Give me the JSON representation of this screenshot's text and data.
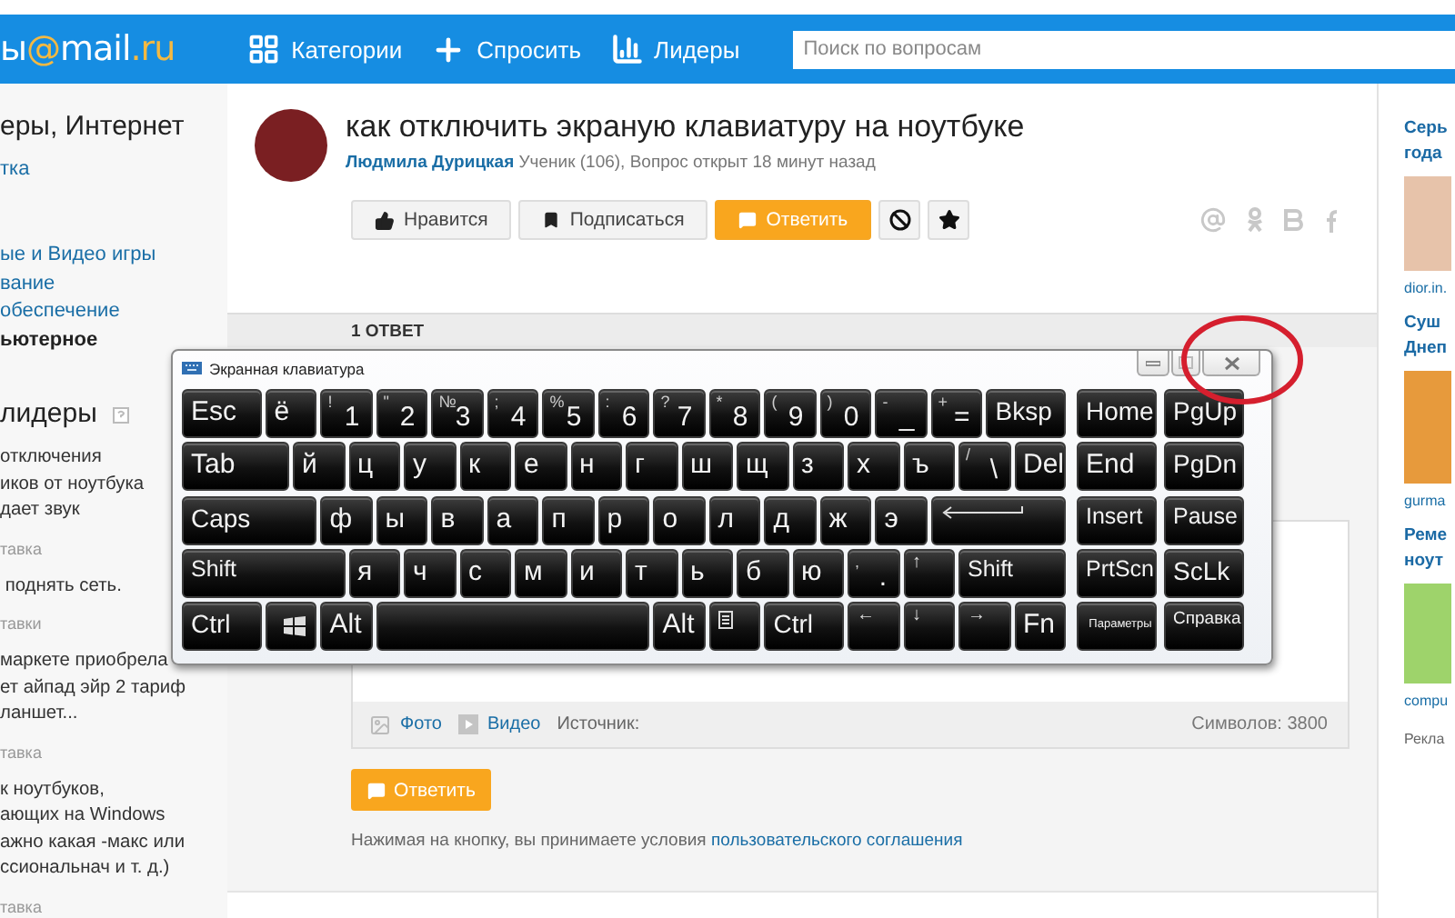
{
  "logo": [
    "ы",
    "@",
    "mail",
    ".ru"
  ],
  "nav": [
    {
      "label": "Категории",
      "kind": "grid"
    },
    {
      "label": "Спросить",
      "kind": "plus"
    },
    {
      "label": "Лидеры",
      "kind": "bars"
    }
  ],
  "search": {
    "placeholder": "Поиск по вопросам"
  },
  "sidebar": {
    "title": "еры, Интернет",
    "link": "тка",
    "categories": [
      {
        "label": "ые и Видео игры",
        "selected": false
      },
      {
        "label": "вание",
        "selected": false
      },
      {
        "label": "обеспечение",
        "selected": false
      },
      {
        "label": "ьютерное",
        "selected": true
      }
    ],
    "leaders_title": "лидеры",
    "questions": [
      {
        "text": "отключения\nиков от ноутбука\nдает звук",
        "meta": "тавка"
      },
      {
        "text": " поднять сеть.",
        "meta": "тавки"
      },
      {
        "text": "маркете приобрела\nет айпад эйр 2 тариф\nланшет...",
        "meta": "тавка"
      },
      {
        "text": "к ноутбуков,\nающих на Windows\nажно какая -макс или\nссиональнач и т. д.)",
        "meta": "тавка"
      }
    ]
  },
  "question": {
    "title": "как отключить экраную клавиатуру на ноутбуке",
    "author": "Людмила Дурицкая",
    "meta": "Ученик (106), Вопрос открыт 18 минут назад",
    "actions": [
      {
        "label": "Нравится",
        "kind": "like"
      },
      {
        "label": "Подписаться",
        "kind": "subscribe"
      },
      {
        "label": "Ответить",
        "kind": "answer"
      },
      {
        "kind": "block"
      },
      {
        "kind": "favorite"
      }
    ],
    "share": [
      {
        "kind": "at"
      },
      {
        "kind": "figure"
      },
      {
        "kind": "b"
      },
      {
        "kind": "f"
      }
    ]
  },
  "answers_label": "1 ОТВЕТ",
  "editor": {
    "attachments": [
      {
        "label": "Фото",
        "kind": "photo"
      },
      {
        "label": "Видео",
        "kind": "video"
      }
    ],
    "source_label": "Источник:",
    "counter": "Символов: 3800"
  },
  "submit": {
    "label": "Ответить"
  },
  "terms": {
    "text": "Нажимая на кнопку, вы принимаете условия ",
    "link": "пользовательского соглашения"
  },
  "ads": [
    {
      "title": "Серь\nгода",
      "source": "dior.in.",
      "kind": "ear"
    },
    {
      "title": "Суш\nДнеп",
      "source": "gurma",
      "kind": "food"
    },
    {
      "title": "Реме\nноут",
      "source": "compu",
      "kind": "battery"
    }
  ],
  "ads_label": "Рекла",
  "keyboard": {
    "title": "Экранная клавиатура",
    "rows": [
      {
        "keys": [
          {
            "kind": "char",
            "label": "Esc"
          },
          {
            "kind": "char",
            "label": "ё"
          },
          {
            "kind": "dual",
            "shift": "!",
            "label": "1"
          },
          {
            "kind": "dual",
            "shift": "\"",
            "label": "2"
          },
          {
            "kind": "dual",
            "shift": "№",
            "label": "3"
          },
          {
            "kind": "dual",
            "shift": ";",
            "label": "4"
          },
          {
            "kind": "dual",
            "shift": "%",
            "label": "5"
          },
          {
            "kind": "dual",
            "shift": ":",
            "label": "6"
          },
          {
            "kind": "dual",
            "shift": "?",
            "label": "7"
          },
          {
            "kind": "dual",
            "shift": "*",
            "label": "8"
          },
          {
            "kind": "dual",
            "shift": "(",
            "label": "9"
          },
          {
            "kind": "dual",
            "shift": ")",
            "label": "0"
          },
          {
            "kind": "dual",
            "shift": "-",
            "label": "_"
          },
          {
            "kind": "dual",
            "shift": "+",
            "label": "="
          },
          {
            "kind": "char",
            "label": "Bksp"
          }
        ]
      },
      {
        "keys": [
          {
            "kind": "char",
            "label": "Tab"
          },
          {
            "kind": "char",
            "label": "й"
          },
          {
            "kind": "char",
            "label": "ц"
          },
          {
            "kind": "char",
            "label": "у"
          },
          {
            "kind": "char",
            "label": "к"
          },
          {
            "kind": "char",
            "label": "е"
          },
          {
            "kind": "char",
            "label": "н"
          },
          {
            "kind": "char",
            "label": "г"
          },
          {
            "kind": "char",
            "label": "ш"
          },
          {
            "kind": "char",
            "label": "щ"
          },
          {
            "kind": "char",
            "label": "з"
          },
          {
            "kind": "char",
            "label": "х"
          },
          {
            "kind": "char",
            "label": "ъ"
          },
          {
            "kind": "dual",
            "shift": "/",
            "label": "\\"
          },
          {
            "kind": "char",
            "label": "Del"
          }
        ]
      },
      {
        "keys": [
          {
            "kind": "char",
            "label": "Caps"
          },
          {
            "kind": "char",
            "label": "ф"
          },
          {
            "kind": "char",
            "label": "ы"
          },
          {
            "kind": "char",
            "label": "в"
          },
          {
            "kind": "char",
            "label": "а"
          },
          {
            "kind": "char",
            "label": "п"
          },
          {
            "kind": "char",
            "label": "р"
          },
          {
            "kind": "char",
            "label": "о"
          },
          {
            "kind": "char",
            "label": "л"
          },
          {
            "kind": "char",
            "label": "д"
          },
          {
            "kind": "char",
            "label": "ж"
          },
          {
            "kind": "char",
            "label": "э"
          },
          {
            "kind": "enter"
          }
        ]
      },
      {
        "keys": [
          {
            "kind": "char",
            "label": "Shift"
          },
          {
            "kind": "char",
            "label": "я"
          },
          {
            "kind": "char",
            "label": "ч"
          },
          {
            "kind": "char",
            "label": "с"
          },
          {
            "kind": "char",
            "label": "м"
          },
          {
            "kind": "char",
            "label": "и"
          },
          {
            "kind": "char",
            "label": "т"
          },
          {
            "kind": "char",
            "label": "ь"
          },
          {
            "kind": "char",
            "label": "б"
          },
          {
            "kind": "char",
            "label": "ю"
          },
          {
            "kind": "dual",
            "shift": ",",
            "label": "."
          },
          {
            "kind": "corner",
            "label": "↑"
          },
          {
            "kind": "char",
            "label": "Shift"
          }
        ]
      },
      {
        "keys": [
          {
            "kind": "char",
            "label": "Ctrl"
          },
          {
            "kind": "win"
          },
          {
            "kind": "char",
            "label": "Alt"
          },
          {
            "kind": "space"
          },
          {
            "kind": "char",
            "label": "Alt"
          },
          {
            "kind": "menu"
          },
          {
            "kind": "char",
            "label": "Ctrl"
          },
          {
            "kind": "corner",
            "label": "←"
          },
          {
            "kind": "corner",
            "label": "↓"
          },
          {
            "kind": "corner",
            "label": "→"
          },
          {
            "kind": "char",
            "label": "Fn"
          }
        ]
      }
    ],
    "nav_rows": [
      {
        "keys": [
          {
            "kind": "char",
            "label": "Home"
          },
          {
            "kind": "char",
            "label": "PgUp"
          }
        ]
      },
      {
        "keys": [
          {
            "kind": "char",
            "label": "End"
          },
          {
            "kind": "char",
            "label": "PgDn"
          }
        ]
      },
      {
        "keys": [
          {
            "kind": "char",
            "label": "Insert"
          },
          {
            "kind": "char",
            "label": "Pause"
          }
        ]
      },
      {
        "keys": [
          {
            "kind": "char",
            "label": "PrtScn"
          },
          {
            "kind": "char",
            "label": "ScLk"
          }
        ]
      },
      {
        "keys": [
          {
            "kind": "tiny",
            "label": "Параметры"
          },
          {
            "kind": "small",
            "label": "Справка"
          }
        ]
      }
    ]
  }
}
